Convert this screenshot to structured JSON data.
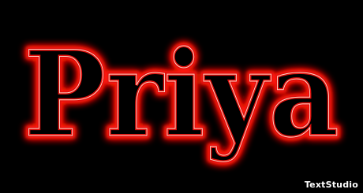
{
  "artwork": {
    "text": "Priya",
    "stroke_color": "#e0100c",
    "glow_color": "#ff1a10",
    "inner_highlight_color": "#ffd6c8",
    "background_color": "#000000"
  },
  "watermark": {
    "text": "TextStudio"
  }
}
